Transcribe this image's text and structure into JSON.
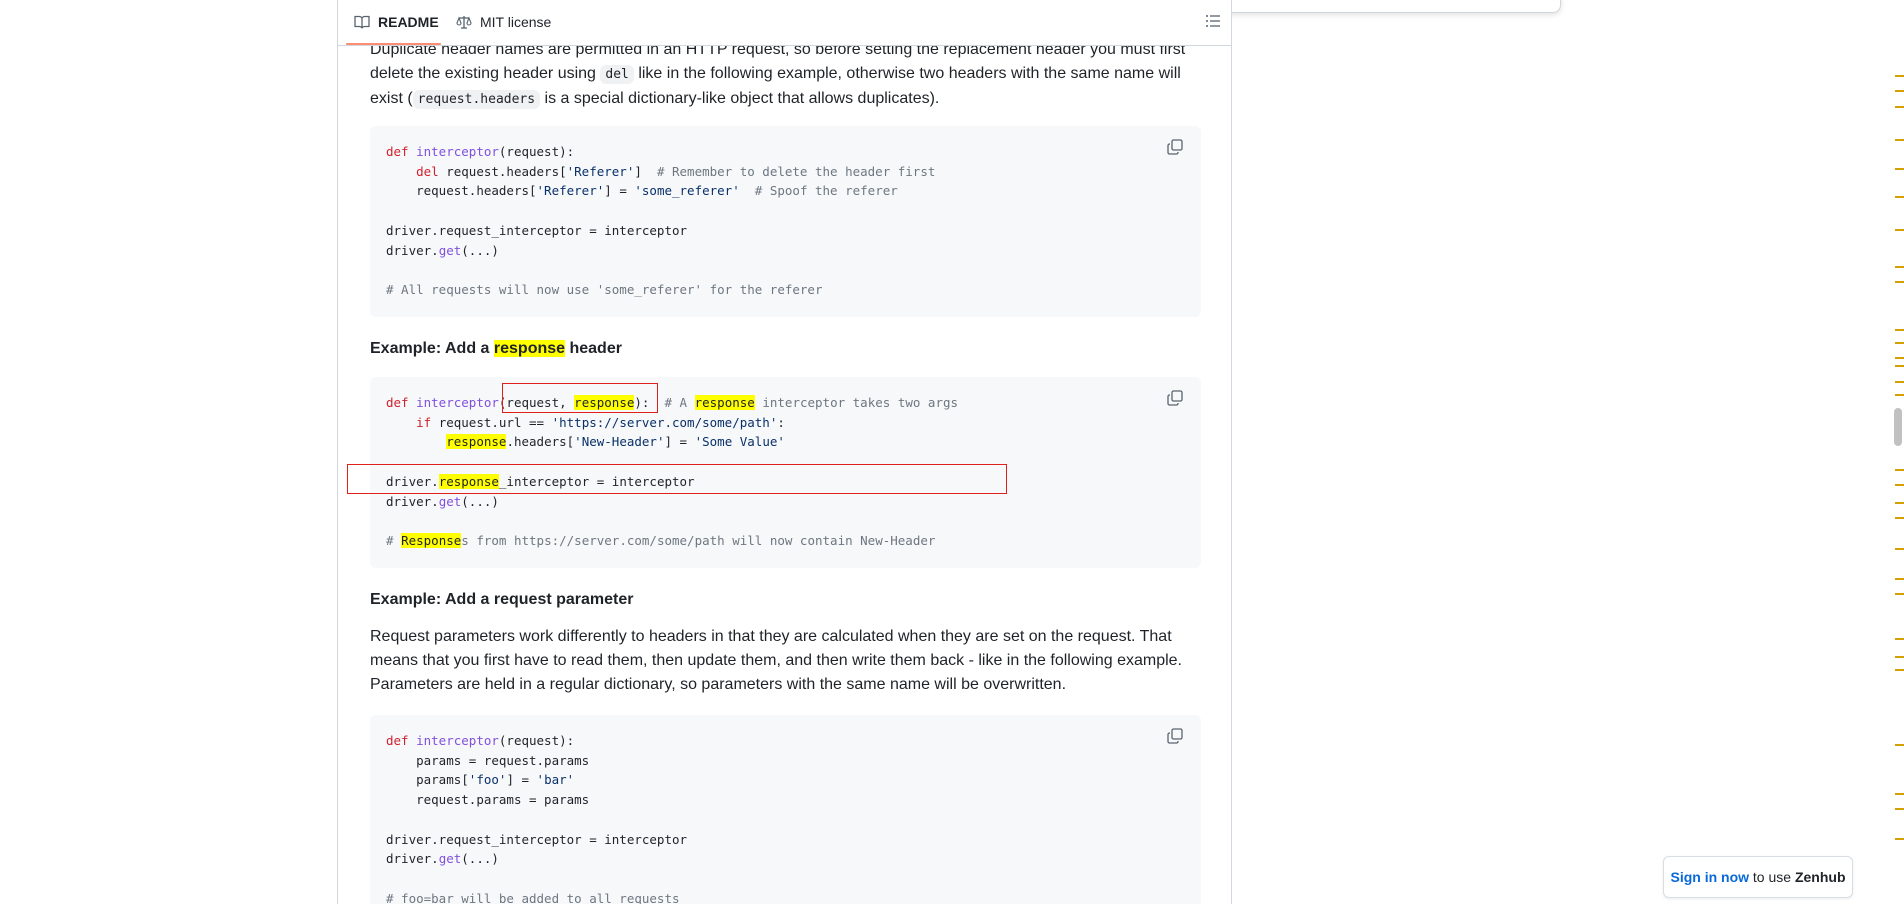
{
  "tabs": {
    "readme": "README",
    "license": "MIT license"
  },
  "intro": {
    "text1": "Duplicate header names are permitted in an HTTP request, so before setting the replacement header you must first delete the existing header using ",
    "code1": "del",
    "text2": " like in the following example, otherwise two headers with the same name will exist (",
    "code2": "request.headers",
    "text3": " is a special dictionary-like object that allows duplicates)."
  },
  "code1": {
    "l1_kw": "def",
    "l1_fn": "interceptor",
    "l1_rest": "(request):",
    "l2_kw": "del",
    "l2_a": " request.headers[",
    "l2_str": "'Referer'",
    "l2_b": "]  ",
    "l2_cm": "# Remember to delete the header first",
    "l3_a": "request.headers[",
    "l3_str1": "'Referer'",
    "l3_b": "] = ",
    "l3_str2": "'some_referer'",
    "l3_c": "  ",
    "l3_cm": "# Spoof the referer",
    "l5": "driver.request_interceptor = interceptor",
    "l6_a": "driver.",
    "l6_fn": "get",
    "l6_b": "(...)",
    "l8_cm": "# All requests will now use 'some_referer' for the referer"
  },
  "heading1": {
    "pre": "Example: Add a ",
    "hl": "response",
    "post": " header"
  },
  "code2": {
    "l1_kw": "def",
    "l1_fn": "interceptor",
    "l1_a": "(request, ",
    "l1_hl": "response",
    "l1_b": "):  ",
    "l1_cm1": "# A ",
    "l1_hl2": "response",
    "l1_cm2": " interceptor takes two args",
    "l2_kw": "if",
    "l2_a": " request.url == ",
    "l2_str": "'https://server.com/some/path'",
    "l2_b": ":",
    "l3_hl": "response",
    "l3_a": ".headers[",
    "l3_str1": "'New-Header'",
    "l3_b": "] = ",
    "l3_str2": "'Some Value'",
    "l5_a": "driver.",
    "l5_hl": "response",
    "l5_b": "_interceptor = interceptor",
    "l6_a": "driver.",
    "l6_fn": "get",
    "l6_b": "(...)",
    "l8_cm1": "# ",
    "l8_hl": "Response",
    "l8_cm2": "s from https://server.com/some/path will now contain New-Header"
  },
  "heading2": "Example: Add a request parameter",
  "para2": "Request parameters work differently to headers in that they are calculated when they are set on the request. That means that you first have to read them, then update them, and then write them back - like in the following example. Parameters are held in a regular dictionary, so parameters with the same name will be overwritten.",
  "code3": {
    "l1_kw": "def",
    "l1_fn": "interceptor",
    "l1_rest": "(request):",
    "l2": "params = request.params",
    "l3_a": "params[",
    "l3_str1": "'foo'",
    "l3_b": "] = ",
    "l3_str2": "'bar'",
    "l4": "request.params = params",
    "l6": "driver.request_interceptor = interceptor",
    "l7_a": "driver.",
    "l7_fn": "get",
    "l7_b": "(...)",
    "l9_cm": "# foo=bar will be added to all requests"
  },
  "zenhub": {
    "link": "Sign in now",
    "text": " to use ",
    "brand": "Zenhub"
  },
  "colors": {
    "highlight": "#ffff00",
    "annotation": "#e0201b",
    "link": "#0969da",
    "tab_underline": "#fd8c73"
  }
}
